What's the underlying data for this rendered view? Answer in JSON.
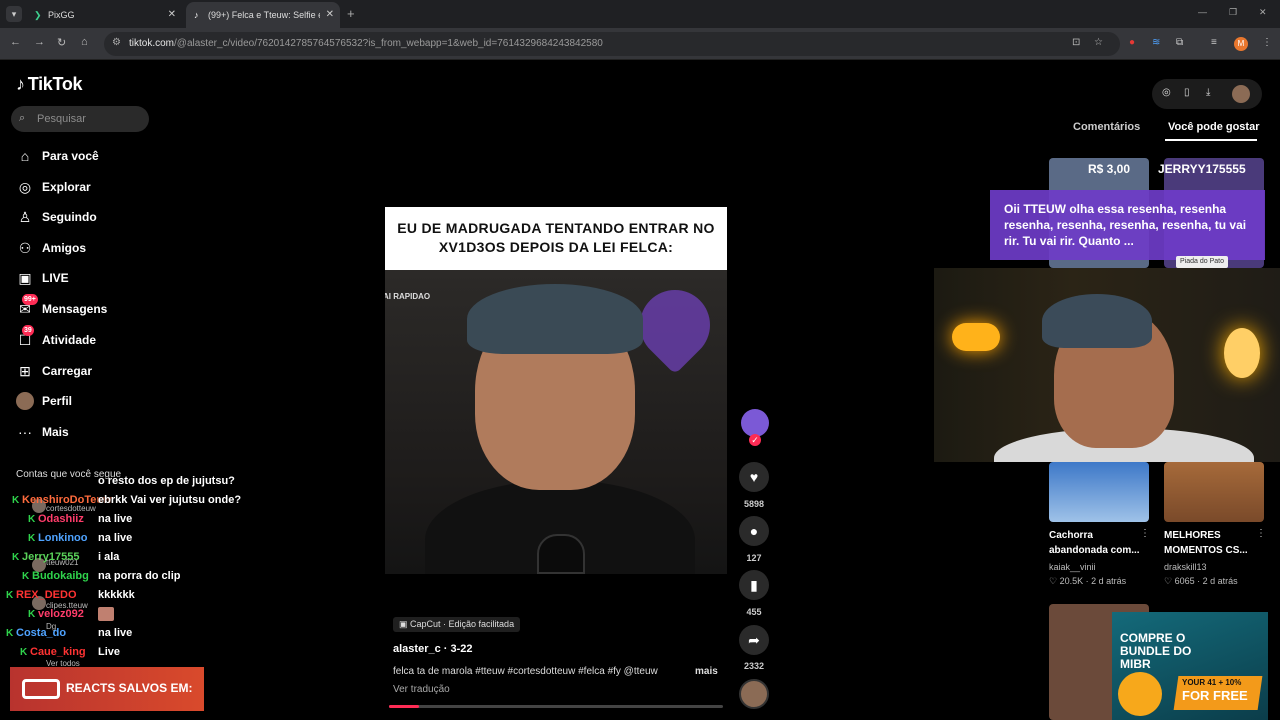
{
  "browser": {
    "tabs": [
      {
        "title": "PixGG",
        "icon": "pixgg-icon"
      },
      {
        "title": "(99+) Felca e Tteuw: Selfie e Dor",
        "icon": "tiktok-icon"
      }
    ],
    "url_main": "tiktok.com",
    "url_rest": "/@alaster_c/video/7620142785764576532?is_from_webapp=1&web_id=7614329684243842580"
  },
  "sidebar": {
    "logo": "TikTok",
    "search_placeholder": "Pesquisar",
    "nav": [
      {
        "label": "Para você",
        "icon": "home-icon"
      },
      {
        "label": "Explorar",
        "icon": "compass-icon"
      },
      {
        "label": "Seguindo",
        "icon": "following-icon"
      },
      {
        "label": "Amigos",
        "icon": "friends-icon"
      },
      {
        "label": "LIVE",
        "icon": "live-icon"
      },
      {
        "label": "Mensagens",
        "icon": "messages-icon",
        "badge": "99+"
      },
      {
        "label": "Atividade",
        "icon": "activity-icon",
        "badge": "39"
      },
      {
        "label": "Carregar",
        "icon": "upload-icon"
      },
      {
        "label": "Perfil",
        "icon": "profile-icon"
      },
      {
        "label": "Mais",
        "icon": "more-icon"
      }
    ],
    "following_header": "Contas que você segue",
    "accounts": [
      "cortesdotteuw",
      "tteuw021",
      "clipes.tteuw",
      "Dg"
    ],
    "see_all": "Ver todos"
  },
  "chat": [
    {
      "user": "",
      "message": "o resto dos ep de jujutsu?",
      "color": "#ffffff"
    },
    {
      "user": "KenshiroDoTeuw",
      "message": "ebrkk Vai ver jujutsu onde?",
      "color": "#ff6b3d"
    },
    {
      "user": "Odashiiz",
      "message": "na live",
      "color": "#ff3d6b"
    },
    {
      "user": "Lonkinoo",
      "message": "na live",
      "color": "#4fa3ff"
    },
    {
      "user": "Jerry17555",
      "message": "i ala",
      "color": "#5ad35a"
    },
    {
      "user": "Budokaibg",
      "message": "na porra do clip",
      "color": "#2fd34c"
    },
    {
      "user": "REX_DEDO",
      "message": "kkkkkk",
      "color": "#ff3333"
    },
    {
      "user": "veloz092",
      "message": "",
      "color": "#ff3d6b"
    },
    {
      "user": "Costa_do",
      "message": "na live",
      "color": "#4fa3ff"
    },
    {
      "user": "Caue_king",
      "message": "Live",
      "color": "#ff3333"
    }
  ],
  "reacts_banner": "REACTS SALVOS EM:",
  "video": {
    "caption": "EU DE MADRUGADA TENTANDO ENTRAR NO XV1D3OS DEPOIS DA LEI FELCA:",
    "side_text": "AI RAPIDAO",
    "capcut": "CapCut · Edição facilitada",
    "author": "alaster_c · 3-22",
    "description": "felca ta de marola #tteuw #cortesdotteuw #felca #fy @tteuw",
    "more": "mais",
    "translate": "Ver tradução",
    "progress": 0.09
  },
  "actions": {
    "likes": "5898",
    "comments": "127",
    "saves": "455",
    "shares": "2332"
  },
  "right_panel": {
    "tabs": [
      "Comentários",
      "Você pode gostar"
    ],
    "active_tab": 1,
    "donation": {
      "amount": "R$ 3,00",
      "name": "JERRYY175555",
      "message": "Oii TTEUW olha essa resenha, resenha resenha, resenha, resenha, resenha, tu vai rir. Tu vai rir. Quanto ...",
      "tag": "Piada do Pato"
    },
    "videos": [
      {
        "title": "Cachorra abandonada com...",
        "author": "kaiak__vinii",
        "likes": "20.5K",
        "age": "2 d atrás"
      },
      {
        "title": "MELHORES MOMENTOS CS...",
        "author": "drakskill13",
        "likes": "6065",
        "age": "2 d atrás"
      }
    ],
    "promo": {
      "line1": "COMPRE O BUNDLE DO MIBR",
      "line2": "YOUR 41 + 10%",
      "line3": "FOR FREE"
    }
  }
}
